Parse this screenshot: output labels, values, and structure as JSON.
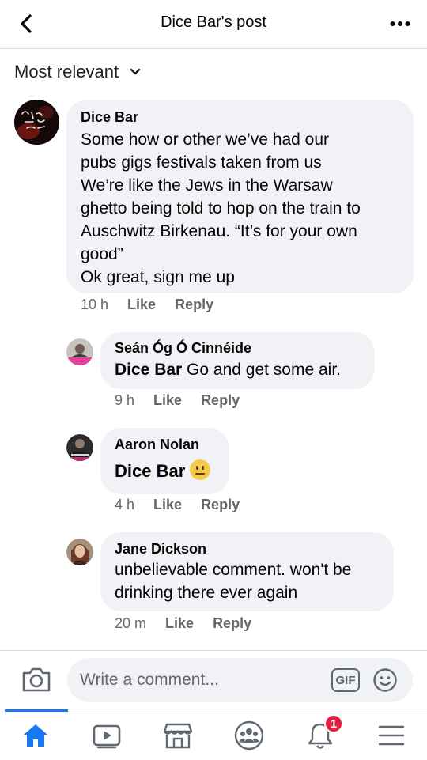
{
  "header": {
    "title": "Dice Bar's post",
    "back_icon": "chevron-left-icon",
    "more_icon": "more-horizontal-icon"
  },
  "sort": {
    "label": "Most relevant",
    "icon": "chevron-down-icon"
  },
  "comments": [
    {
      "author": "Dice Bar",
      "lines": [
        "Some how or other we’ve had our",
        "pubs gigs festivals taken from us",
        "We’re like the Jews in the Warsaw",
        "ghetto being told to hop on the train to",
        "Auschwitz Birkenau. “It’s for your own",
        "good”",
        "Ok great, sign me up"
      ],
      "time": "10 h",
      "like_label": "Like",
      "reply_label": "Reply"
    },
    {
      "author": "Seán Óg Ó Cinnéide",
      "mention": "Dice Bar",
      "text": " Go and get some air.",
      "time": "9 h",
      "like_label": "Like",
      "reply_label": "Reply"
    },
    {
      "author": "Aaron Nolan",
      "mention": "Dice Bar",
      "emoji": "neutral-face-emoji",
      "time": "4 h",
      "like_label": "Like",
      "reply_label": "Reply"
    },
    {
      "author": "Jane Dickson",
      "lines": [
        "unbelievable comment. won't be",
        "drinking there ever again"
      ],
      "time": "20 m",
      "like_label": "Like",
      "reply_label": "Reply"
    }
  ],
  "composer": {
    "placeholder": "Write a comment...",
    "gif_label": "GIF",
    "camera_icon": "camera-icon",
    "emoji_icon": "smiley-icon"
  },
  "tabbar": {
    "items": [
      "home-icon",
      "watch-icon",
      "marketplace-icon",
      "groups-icon",
      "notifications-icon",
      "menu-icon"
    ],
    "notification_count": "1",
    "active_color": "#1877f2"
  },
  "colors": {
    "bubble": "#f0f2f5",
    "meta_text": "#65676b",
    "badge": "#e41e3f"
  }
}
